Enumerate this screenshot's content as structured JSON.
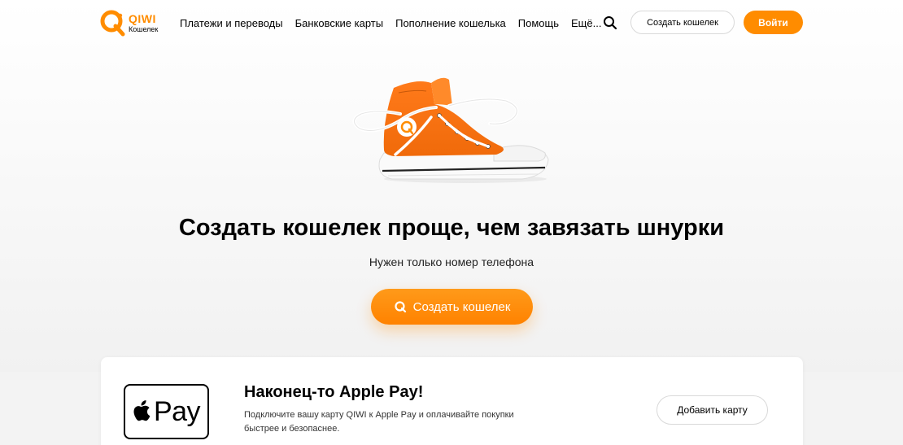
{
  "brand": {
    "name": "QIWI",
    "subtitle": "Кошелек",
    "accent_color": "#ff8c00"
  },
  "nav": {
    "items": [
      {
        "label": "Платежи и переводы"
      },
      {
        "label": "Банковские карты"
      },
      {
        "label": "Пополнение кошелька"
      },
      {
        "label": "Помощь"
      },
      {
        "label": "Ещё..."
      }
    ],
    "search_icon": "search-icon",
    "create_wallet_label": "Создать кошелек",
    "login_label": "Войти"
  },
  "hero": {
    "image": "orange-sneaker",
    "title": "Создать кошелек проще, чем завязать шнурки",
    "subtitle": "Нужен только номер телефона",
    "cta_label": "Создать кошелек",
    "cta_icon": "qiwi-icon"
  },
  "apple_pay": {
    "logo_icon": "apple-icon",
    "logo_text": "Pay",
    "title": "Наконец-то Apple Pay!",
    "description": "Подключите вашу карту QIWI к Apple Pay и оплачивайте покупки быстрее и безопаснее.",
    "button_label": "Добавить карту"
  }
}
